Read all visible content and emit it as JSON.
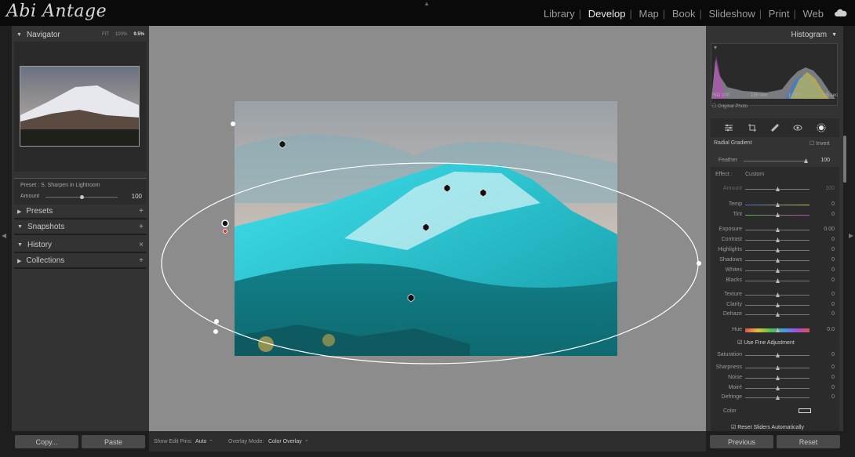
{
  "app": {
    "logo_text": "Abi Antage",
    "modules": [
      "Library",
      "Develop",
      "Map",
      "Book",
      "Slideshow",
      "Print",
      "Web"
    ],
    "active_module": "Develop"
  },
  "left": {
    "navigator": {
      "title": "Navigator",
      "zoom_options": [
        "FIT",
        "100%",
        "9.5%"
      ]
    },
    "preset": {
      "label": "Preset : S. Sharpen in Lightroom",
      "amount_label": "Amount",
      "amount_value": "100"
    },
    "sections": [
      {
        "label": "Presets",
        "action": "+"
      },
      {
        "label": "Snapshots",
        "action": "+"
      },
      {
        "label": "History",
        "action": "×"
      },
      {
        "label": "Collections",
        "action": "+"
      }
    ],
    "copy_button": "Copy...",
    "paste_button": "Paste"
  },
  "bottom_toolbar": {
    "edit_pins_label": "Show Edit Pins:",
    "edit_pins_value": "Auto",
    "overlay_label": "Overlay Mode:",
    "overlay_value": "Color Overlay"
  },
  "right": {
    "histogram_title": "Histogram",
    "meta": [
      "ISO 100",
      "138 mm",
      "ƒ / 8.0",
      "1/5 sec"
    ],
    "original_photo": "Original Photo",
    "tool_title": "Radial Gradient",
    "invert_label": "Invert",
    "feather_label": "Feather",
    "feather_value": "100",
    "effect_label": "Effect :",
    "effect_value": "Custom",
    "sliders": [
      {
        "label": "Amount",
        "value": "100",
        "pos": 0.5
      },
      {
        "label": "Temp",
        "value": "0",
        "pos": 0.5
      },
      {
        "label": "Tint",
        "value": "0",
        "pos": 0.5
      },
      {
        "label": "Exposure",
        "value": "0.00",
        "pos": 0.5
      },
      {
        "label": "Contrast",
        "value": "0",
        "pos": 0.5
      },
      {
        "label": "Highlights",
        "value": "0",
        "pos": 0.5
      },
      {
        "label": "Shadows",
        "value": "0",
        "pos": 0.5
      },
      {
        "label": "Whites",
        "value": "0",
        "pos": 0.5
      },
      {
        "label": "Blacks",
        "value": "0",
        "pos": 0.5
      },
      {
        "label": "Texture",
        "value": "0",
        "pos": 0.5
      },
      {
        "label": "Clarity",
        "value": "0",
        "pos": 0.5
      },
      {
        "label": "Dehaze",
        "value": "0",
        "pos": 0.5
      },
      {
        "label": "Hue",
        "value": "0.0",
        "pos": 0.5
      },
      {
        "label": "Saturation",
        "value": "0",
        "pos": 0.5
      },
      {
        "label": "Sharpness",
        "value": "0",
        "pos": 0.5
      },
      {
        "label": "Noise",
        "value": "0",
        "pos": 0.5
      },
      {
        "label": "Moiré",
        "value": "0",
        "pos": 0.5
      },
      {
        "label": "Defringe",
        "value": "0",
        "pos": 0.5
      }
    ],
    "fine_adjust_label": "Use Fine Adjustment",
    "color_label": "Color",
    "reset_sliders_label": "Reset Sliders Automatically",
    "previous_button": "Previous",
    "reset_button": "Reset"
  }
}
